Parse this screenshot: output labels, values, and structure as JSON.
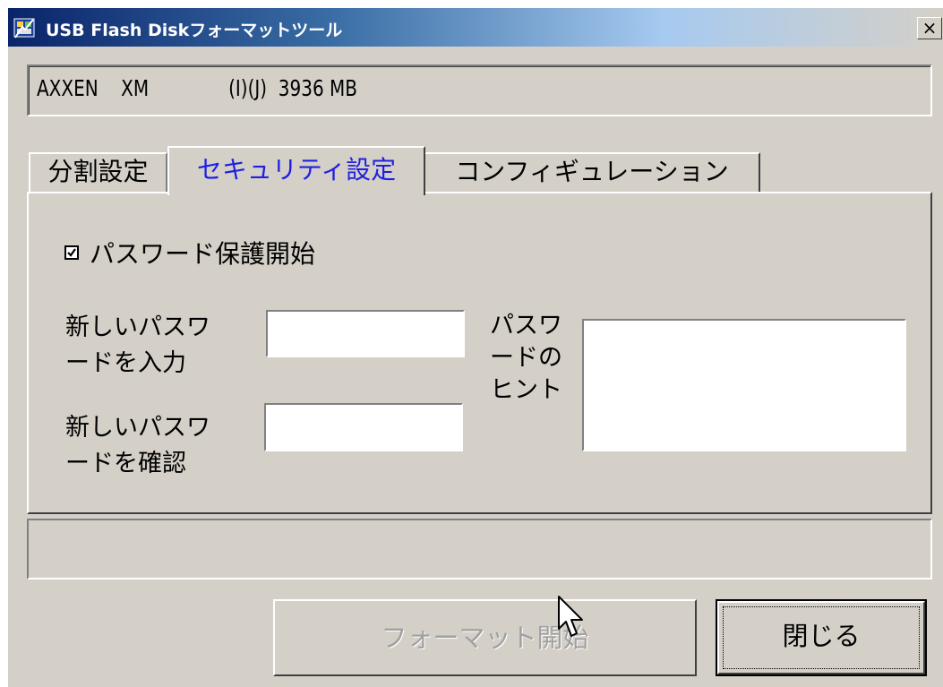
{
  "window": {
    "title": "USB Flash Diskフォーマットツール",
    "close_glyph": "×"
  },
  "device": {
    "info": "AXXEN    XM              (I)(J)  3936 MB"
  },
  "tabs": [
    {
      "label": "分割設定",
      "active": false
    },
    {
      "label": "セキュリティ設定",
      "active": true
    },
    {
      "label": "コンフィギュレーション",
      "active": false
    }
  ],
  "security": {
    "enable_label": "パスワード保護開始",
    "enable_checked": true,
    "new_password_label": "新しいパスワ\nードを入力",
    "new_password_value": "",
    "confirm_password_label": "新しいパスワ\nードを確認",
    "confirm_password_value": "",
    "hint_label": "パスワ\nードの\nヒント",
    "hint_value": ""
  },
  "status": {
    "text": ""
  },
  "buttons": {
    "format_label": "フォーマット開始",
    "format_enabled": false,
    "close_label": "閉じる"
  },
  "colors": {
    "active_tab_text": "#2020e0",
    "dialog_face": "#d4d0c8",
    "title_gradient_start": "#0a246a"
  }
}
